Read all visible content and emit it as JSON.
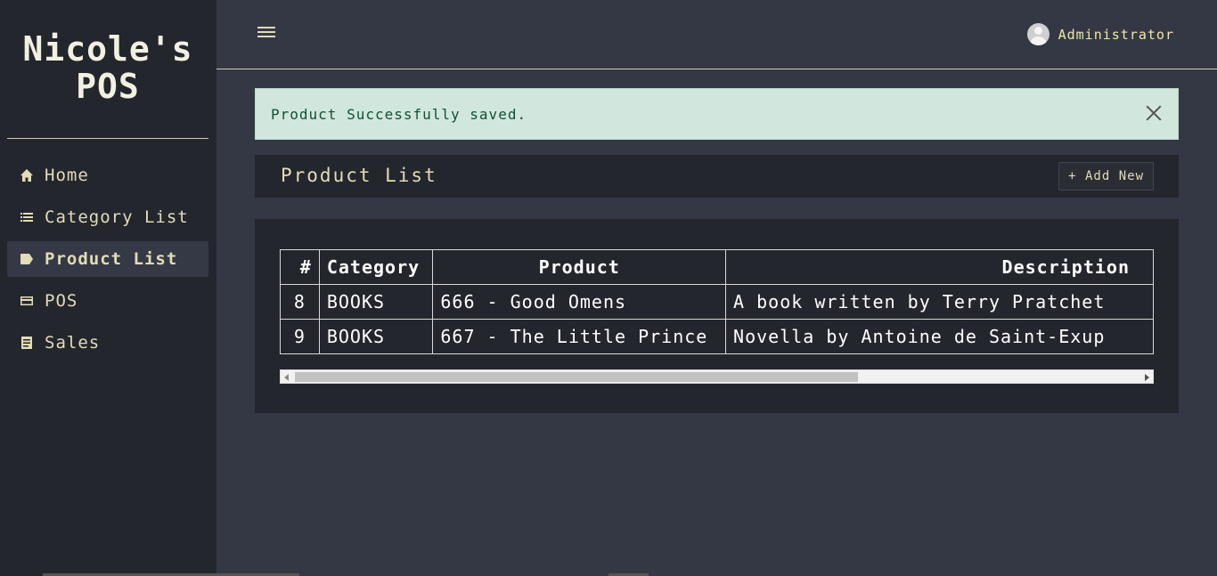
{
  "brand": {
    "line1": "Nicole's",
    "line2": "POS"
  },
  "sidebar": {
    "items": [
      {
        "label": "Home",
        "icon": "home-icon"
      },
      {
        "label": "Category List",
        "icon": "list-icon"
      },
      {
        "label": "Product List",
        "icon": "tag-icon",
        "active": true
      },
      {
        "label": "POS",
        "icon": "card-icon"
      },
      {
        "label": "Sales",
        "icon": "receipt-icon"
      }
    ]
  },
  "topbar": {
    "user_name": "Administrator"
  },
  "alert": {
    "message": "Product Successfully saved."
  },
  "header": {
    "title": "Product List",
    "add_label": "+ Add New"
  },
  "table": {
    "columns": [
      "#",
      "Category",
      "Product",
      "Description"
    ],
    "rows": [
      [
        "8",
        "BOOKS",
        "666 - Good Omens",
        "A book written by Terry Pratchet"
      ],
      [
        "9",
        "BOOKS",
        "667 - The Little Prince",
        "Novella by Antoine de Saint-Exup"
      ]
    ]
  },
  "colors": {
    "sidebar_bg": "#24262e",
    "page_bg": "#343845",
    "alert_bg": "#d1e7dd",
    "accent_text": "#e2dcb6"
  }
}
